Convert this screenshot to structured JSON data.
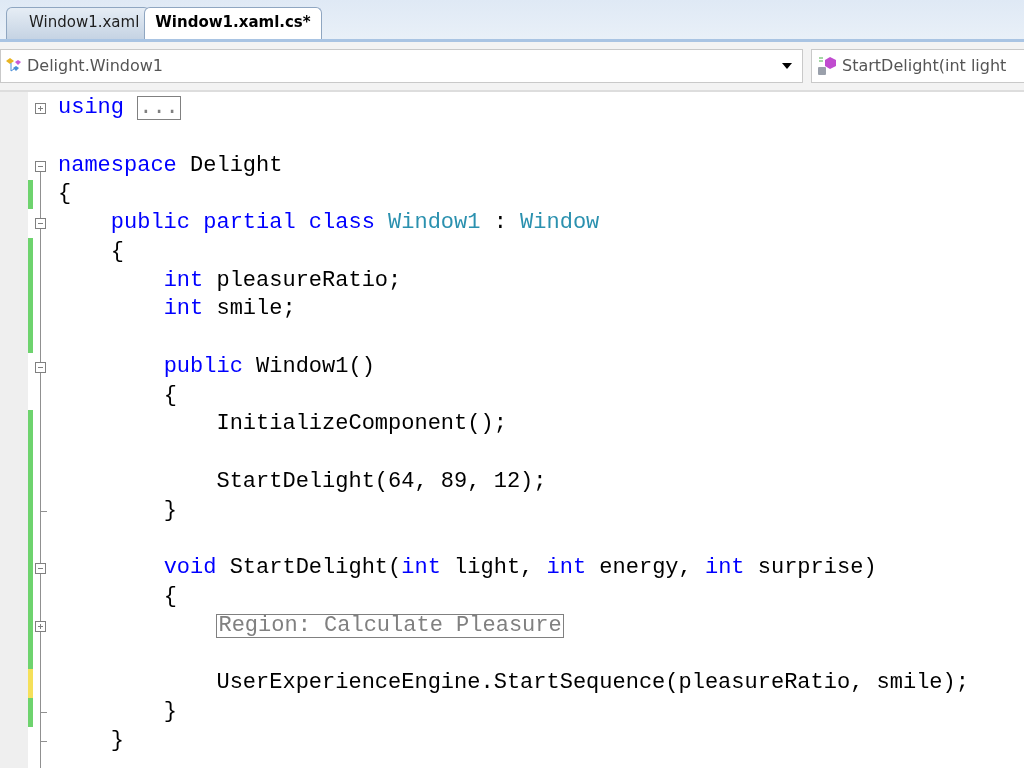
{
  "tabs": [
    {
      "label": "Window1.xaml",
      "selected": false
    },
    {
      "label": "Window1.xaml.cs*",
      "selected": true
    }
  ],
  "navigation": {
    "type_dropdown": {
      "value": "Delight.Window1"
    },
    "member_dropdown": {
      "value": "StartDelight(int light"
    }
  },
  "code_lines": [
    {
      "kind": "closed",
      "tokens": [
        {
          "kind": "keyword",
          "text": "using"
        },
        {
          "kind": "collapsed",
          "text": "..."
        }
      ]
    },
    {
      "kind": "plain"
    },
    {
      "kind": "open",
      "tokens": [
        {
          "kind": "keyword",
          "text": "namespace"
        },
        {
          "kind": "plain",
          "text": " Delight"
        }
      ]
    },
    {
      "kind": "plain",
      "color": "#6ed36e",
      "tokens": [
        {
          "kind": "plain",
          "text": "{"
        }
      ]
    },
    {
      "kind": "open",
      "tokens": [
        {
          "kind": "keyword",
          "text": "    public partial class"
        },
        {
          "kind": "type",
          "text": " Window1"
        },
        {
          "kind": "plain",
          "text": " : "
        },
        {
          "kind": "type",
          "text": "Window"
        }
      ]
    },
    {
      "kind": "plain",
      "color": "#6ed36e",
      "tokens": [
        {
          "kind": "plain",
          "text": "    {"
        }
      ]
    },
    {
      "kind": "plain",
      "color": "#6ed36e",
      "tokens": [
        {
          "kind": "keyword",
          "text": "        int"
        },
        {
          "kind": "plain",
          "text": " pleasureRatio;"
        }
      ]
    },
    {
      "kind": "plain",
      "color": "#6ed36e",
      "tokens": [
        {
          "kind": "keyword",
          "text": "        int"
        },
        {
          "kind": "plain",
          "text": " smile;"
        }
      ]
    },
    {
      "kind": "plain",
      "color": "#6ed36e"
    },
    {
      "kind": "open",
      "tokens": [
        {
          "kind": "keyword",
          "text": "        public"
        },
        {
          "kind": "plain",
          "text": " Window1()"
        }
      ]
    },
    {
      "kind": "plain",
      "tokens": [
        {
          "kind": "plain",
          "text": "        {"
        }
      ]
    },
    {
      "kind": "plain",
      "color": "#6ed36e",
      "tokens": [
        {
          "kind": "plain",
          "text": "            InitializeComponent();"
        }
      ]
    },
    {
      "kind": "plain",
      "color": "#6ed36e"
    },
    {
      "kind": "plain",
      "color": "#6ed36e",
      "tokens": [
        {
          "kind": "plain",
          "text": "            StartDelight(64, 89, 12);"
        }
      ]
    },
    {
      "kind": "end",
      "color": "#6ed36e",
      "tokens": [
        {
          "kind": "plain",
          "text": "        }"
        }
      ]
    },
    {
      "kind": "plain",
      "color": "#6ed36e"
    },
    {
      "kind": "open",
      "color": "#6ed36e",
      "tokens": [
        {
          "kind": "keyword",
          "text": "        void"
        },
        {
          "kind": "plain",
          "text": " StartDelight("
        },
        {
          "kind": "keyword",
          "text": "int"
        },
        {
          "kind": "plain",
          "text": " light, "
        },
        {
          "kind": "keyword",
          "text": "int"
        },
        {
          "kind": "plain",
          "text": " energy, "
        },
        {
          "kind": "keyword",
          "text": "int"
        },
        {
          "kind": "plain",
          "text": " surprise)"
        }
      ]
    },
    {
      "kind": "plain",
      "color": "#6ed36e",
      "tokens": [
        {
          "kind": "plain",
          "text": "        {"
        }
      ]
    },
    {
      "kind": "closed",
      "color": "#6ed36e",
      "tokens": [
        {
          "kind": "collapsed",
          "text": "Region: Calculate Pleasure"
        }
      ]
    },
    {
      "kind": "plain",
      "color": "#6ed36e"
    },
    {
      "kind": "plain",
      "color": "#f5e05a",
      "tokens": [
        {
          "kind": "plain",
          "text": "            UserExperienceEngine.StartSequence(pleasureRatio, smile);"
        }
      ]
    },
    {
      "kind": "end",
      "color": "#6ed36e",
      "tokens": [
        {
          "kind": "plain",
          "text": "        }"
        }
      ]
    },
    {
      "kind": "end",
      "tokens": [
        {
          "kind": "plain",
          "text": "    }"
        }
      ]
    }
  ]
}
